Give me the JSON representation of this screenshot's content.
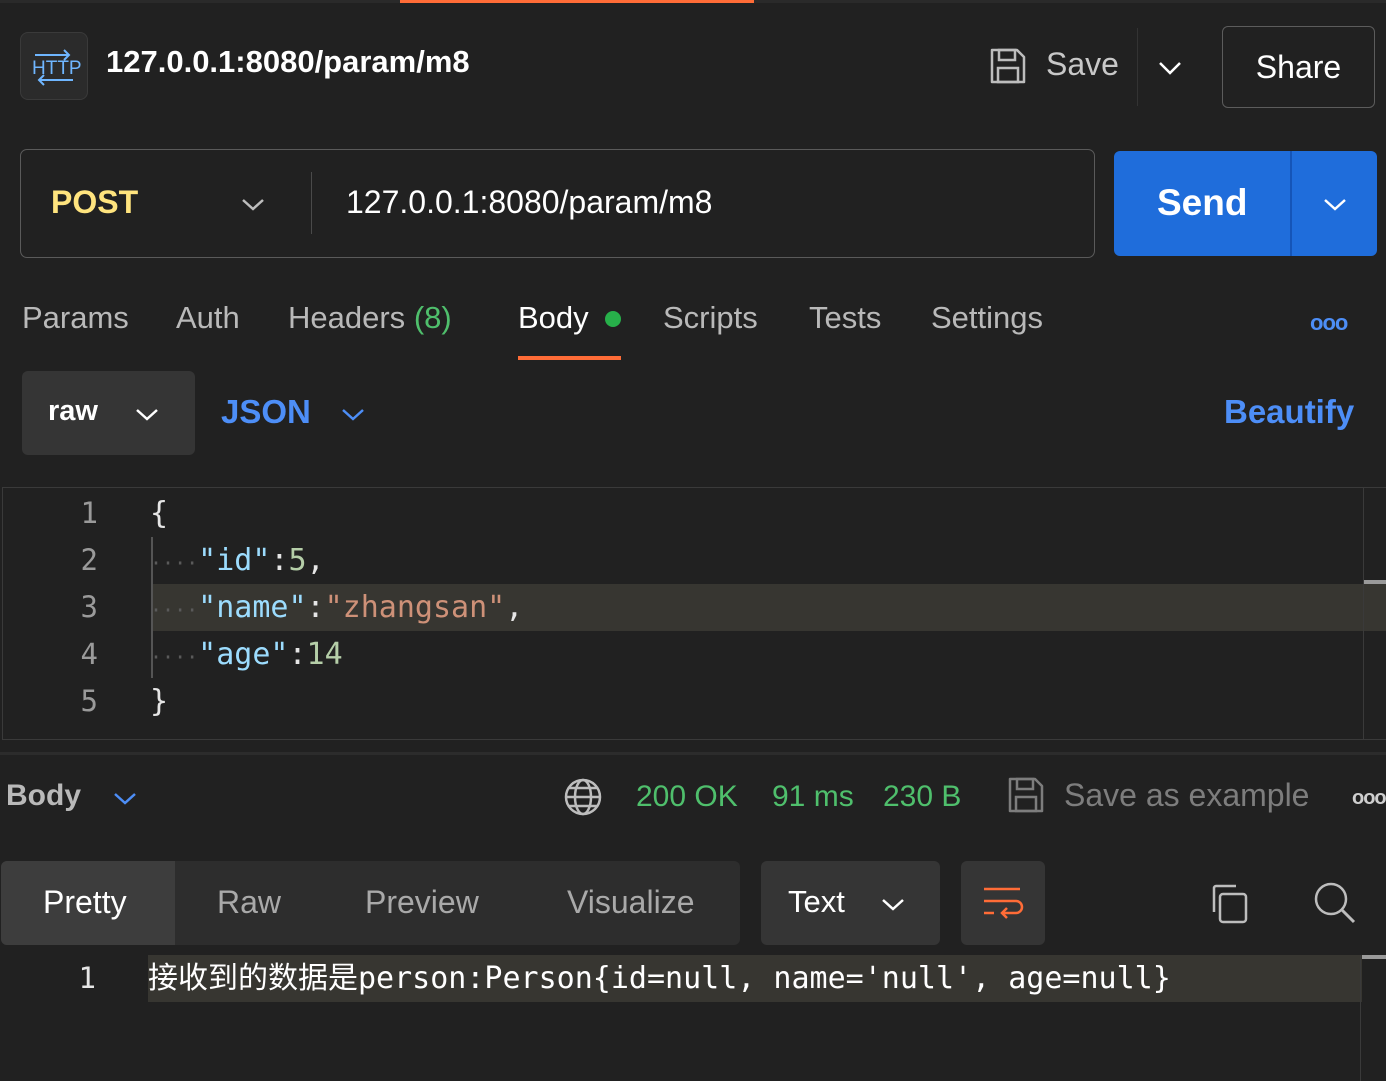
{
  "header": {
    "icon_label": "HTTP",
    "title": "127.0.0.1:8080/param/m8",
    "save_label": "Save",
    "share_label": "Share"
  },
  "request": {
    "method": "POST",
    "url": "127.0.0.1:8080/param/m8",
    "send_label": "Send"
  },
  "tabs": {
    "params": "Params",
    "auth": "Auth",
    "headers": "Headers",
    "headers_count": "(8)",
    "body": "Body",
    "scripts": "Scripts",
    "tests": "Tests",
    "settings": "Settings",
    "more": "ooo"
  },
  "body_options": {
    "mode": "raw",
    "format": "JSON",
    "beautify": "Beautify"
  },
  "editor": {
    "line_numbers": [
      "1",
      "2",
      "3",
      "4",
      "5"
    ],
    "lines": {
      "open": "{",
      "id_key": "\"id\"",
      "id_val": "5",
      "name_key": "\"name\"",
      "name_val": "\"zhangsan\"",
      "age_key": "\"age\"",
      "age_val": "14",
      "close": "}"
    }
  },
  "response": {
    "section_label": "Body",
    "status": "200 OK",
    "time": "91 ms",
    "size": "230 B",
    "save_example": "Save as example",
    "more": "ooo",
    "views": [
      "Pretty",
      "Raw",
      "Preview",
      "Visualize"
    ],
    "format": "Text",
    "line_number": "1",
    "content": "接收到的数据是person:Person{id=null, name='null', age=null}"
  },
  "colors": {
    "accent_orange": "#ff6c37",
    "send_blue": "#1f6ddb",
    "link_blue": "#4d8ef7",
    "status_green": "#4fbf6c",
    "method_yellow": "#ffe47e"
  }
}
